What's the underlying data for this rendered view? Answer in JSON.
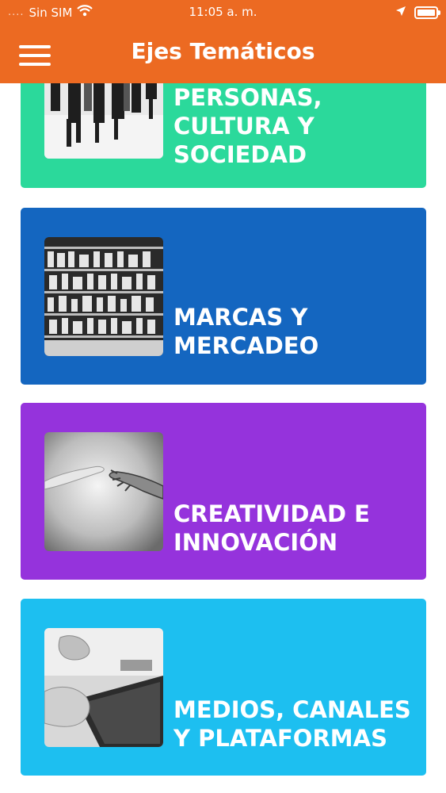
{
  "status_bar": {
    "carrier": "Sin SIM",
    "dots": "....",
    "time": "11:05 a. m.",
    "icons": [
      "wifi-icon",
      "location-arrow-icon",
      "battery-icon"
    ]
  },
  "header": {
    "title": "Ejes Temáticos",
    "menu_icon": "hamburger-menu-icon",
    "color": "#ec6a22"
  },
  "cards": [
    {
      "label": "PERSONAS,\nCULTURA Y\nSOCIEDAD",
      "color": "#2bd99b",
      "image": "people-walking-photo"
    },
    {
      "label": "MARCAS Y\nMERCADEO",
      "color": "#1466c0",
      "image": "supermarket-shelves-photo"
    },
    {
      "label": "CREATIVIDAD E\nINNOVACIÓN",
      "color": "#9533dc",
      "image": "human-robot-hands-photo"
    },
    {
      "label": "MEDIOS, CANALES\nY PLATAFORMAS",
      "color": "#1dbff0",
      "image": "hands-tablet-photo"
    }
  ]
}
